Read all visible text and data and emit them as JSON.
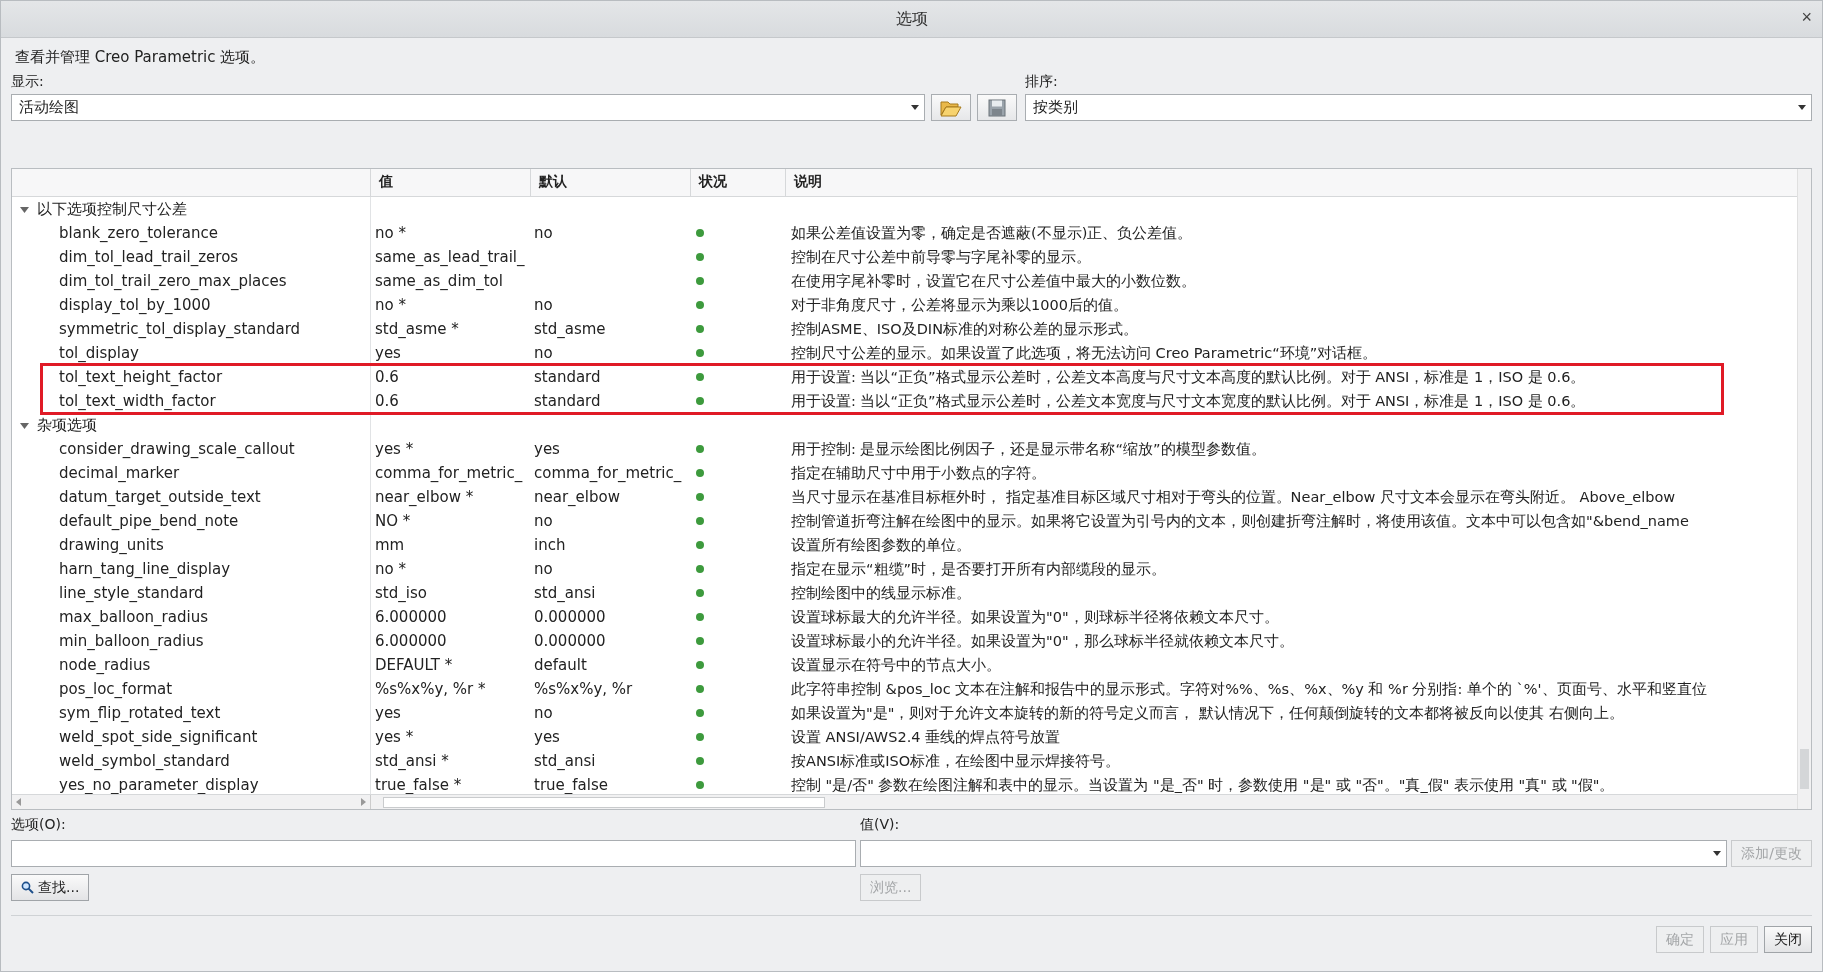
{
  "window": {
    "title": "选项",
    "close": "×"
  },
  "intro": "查看并管理 Creo Parametric 选项。",
  "display": {
    "label": "显示:",
    "value": "活动绘图"
  },
  "sort": {
    "label": "排序:",
    "value": "按类别"
  },
  "table": {
    "columns": [
      "值",
      "默认",
      "状况",
      "说明"
    ],
    "groups": [
      {
        "title": "以下选项控制尺寸公差",
        "expanded": true,
        "rows": [
          {
            "name": "blank_zero_tolerance",
            "value": "no *",
            "default": "no",
            "description": "如果公差值设置为零，确定是否遮蔽(不显示)正、负公差值。",
            "highlighted": false
          },
          {
            "name": "dim_tol_lead_trail_zeros",
            "value": "same_as_lead_trail_",
            "default": "",
            "description": "控制在尺寸公差中前导零与字尾补零的显示。",
            "highlighted": false
          },
          {
            "name": "dim_tol_trail_zero_max_places",
            "value": "same_as_dim_tol",
            "default": "",
            "description": "在使用字尾补零时，设置它在尺寸公差值中最大的小数位数。",
            "highlighted": false
          },
          {
            "name": "display_tol_by_1000",
            "value": "no *",
            "default": "no",
            "description": "对于非角度尺寸，公差将显示为乘以1000后的值。",
            "highlighted": false
          },
          {
            "name": "symmetric_tol_display_standard",
            "value": "std_asme *",
            "default": "std_asme",
            "description": "控制ASME、ISO及DIN标准的对称公差的显示形式。",
            "highlighted": false
          },
          {
            "name": "tol_display",
            "value": "yes",
            "default": "no",
            "description": "控制尺寸公差的显示。如果设置了此选项，将无法访问 Creo Parametric“环境”对话框。",
            "highlighted": false
          },
          {
            "name": "tol_text_height_factor",
            "value": "0.6",
            "default": "standard",
            "description": "用于设置: 当以“正负”格式显示公差时，公差文本高度与尺寸文本高度的默认比例。对于 ANSI，标准是 1，ISO 是 0.6。",
            "highlighted": true
          },
          {
            "name": "tol_text_width_factor",
            "value": "0.6",
            "default": "standard",
            "description": "用于设置: 当以“正负”格式显示公差时，公差文本宽度与尺寸文本宽度的默认比例。对于 ANSI，标准是 1，ISO 是 0.6。",
            "highlighted": true
          }
        ]
      },
      {
        "title": "杂项选项",
        "expanded": true,
        "rows": [
          {
            "name": "consider_drawing_scale_callout",
            "value": "yes *",
            "default": "yes",
            "description": "用于控制: 是显示绘图比例因子，还是显示带名称“缩放”的模型参数值。",
            "highlighted": false
          },
          {
            "name": "decimal_marker",
            "value": "comma_for_metric_",
            "default": "comma_for_metric_",
            "description": "指定在辅助尺寸中用于小数点的字符。",
            "highlighted": false
          },
          {
            "name": "datum_target_outside_text",
            "value": "near_elbow *",
            "default": "near_elbow",
            "description": "当尺寸显示在基准目标框外时， 指定基准目标区域尺寸相对于弯头的位置。Near_elbow 尺寸文本会显示在弯头附近。 Above_elbow",
            "highlighted": false
          },
          {
            "name": "default_pipe_bend_note",
            "value": "NO *",
            "default": "no",
            "description": "控制管道折弯注解在绘图中的显示。如果将它设置为引号内的文本，则创建折弯注解时，将使用该值。文本中可以包含如\"&bend_name",
            "highlighted": false
          },
          {
            "name": "drawing_units",
            "value": "mm",
            "default": "inch",
            "description": "设置所有绘图参数的单位。",
            "highlighted": false
          },
          {
            "name": "harn_tang_line_display",
            "value": "no *",
            "default": "no",
            "description": "指定在显示“粗缆”时，是否要打开所有内部缆段的显示。",
            "highlighted": false
          },
          {
            "name": "line_style_standard",
            "value": "std_iso",
            "default": "std_ansi",
            "description": "控制绘图中的线显示标准。",
            "highlighted": false
          },
          {
            "name": "max_balloon_radius",
            "value": "6.000000",
            "default": "0.000000",
            "description": "设置球标最大的允许半径。如果设置为\"0\"，则球标半径将依赖文本尺寸。",
            "highlighted": false
          },
          {
            "name": "min_balloon_radius",
            "value": "6.000000",
            "default": "0.000000",
            "description": "设置球标最小的允许半径。如果设置为\"0\"，那么球标半径就依赖文本尺寸。",
            "highlighted": false
          },
          {
            "name": "node_radius",
            "value": "DEFAULT *",
            "default": "default",
            "description": "设置显示在符号中的节点大小。",
            "highlighted": false
          },
          {
            "name": "pos_loc_format",
            "value": "%s%x%y, %r *",
            "default": "%s%x%y, %r",
            "description": "此字符串控制 &pos_loc 文本在注解和报告中的显示形式。字符对%%、%s、%x、%y 和 %r 分别指: 单个的 `%'、页面号、水平和竖直位",
            "highlighted": false
          },
          {
            "name": "sym_flip_rotated_text",
            "value": "yes",
            "default": "no",
            "description": "如果设置为\"是\"，则对于允许文本旋转的新的符号定义而言， 默认情况下，任何颠倒旋转的文本都将被反向以使其 右侧向上。",
            "highlighted": false
          },
          {
            "name": "weld_spot_side_significant",
            "value": "yes *",
            "default": "yes",
            "description": "设置 ANSI/AWS2.4 垂线的焊点符号放置",
            "highlighted": false
          },
          {
            "name": "weld_symbol_standard",
            "value": "std_ansi *",
            "default": "std_ansi",
            "description": "按ANSI标准或ISO标准，在绘图中显示焊接符号。",
            "highlighted": false
          },
          {
            "name": "yes_no_parameter_display",
            "value": "true_false *",
            "default": "true_false",
            "description": "控制 \"是/否\" 参数在绘图注解和表中的显示。当设置为 \"是_否\" 时，参数使用 \"是\" 或 \"否\"。\"真_假\" 表示使用 \"真\" 或 \"假\"。",
            "highlighted": false
          }
        ]
      }
    ]
  },
  "option_field": {
    "label": "选项(O):"
  },
  "value_field": {
    "label": "值(V):"
  },
  "buttons": {
    "add": {
      "label": "添加/更改",
      "disabled": true
    },
    "find": {
      "label": "查找...",
      "disabled": false
    },
    "browse": {
      "label": "浏览...",
      "disabled": true
    }
  },
  "footer_buttons": [
    {
      "label": "确定",
      "disabled": true
    },
    {
      "label": "应用",
      "disabled": true
    },
    {
      "label": "关闭",
      "disabled": false
    }
  ]
}
